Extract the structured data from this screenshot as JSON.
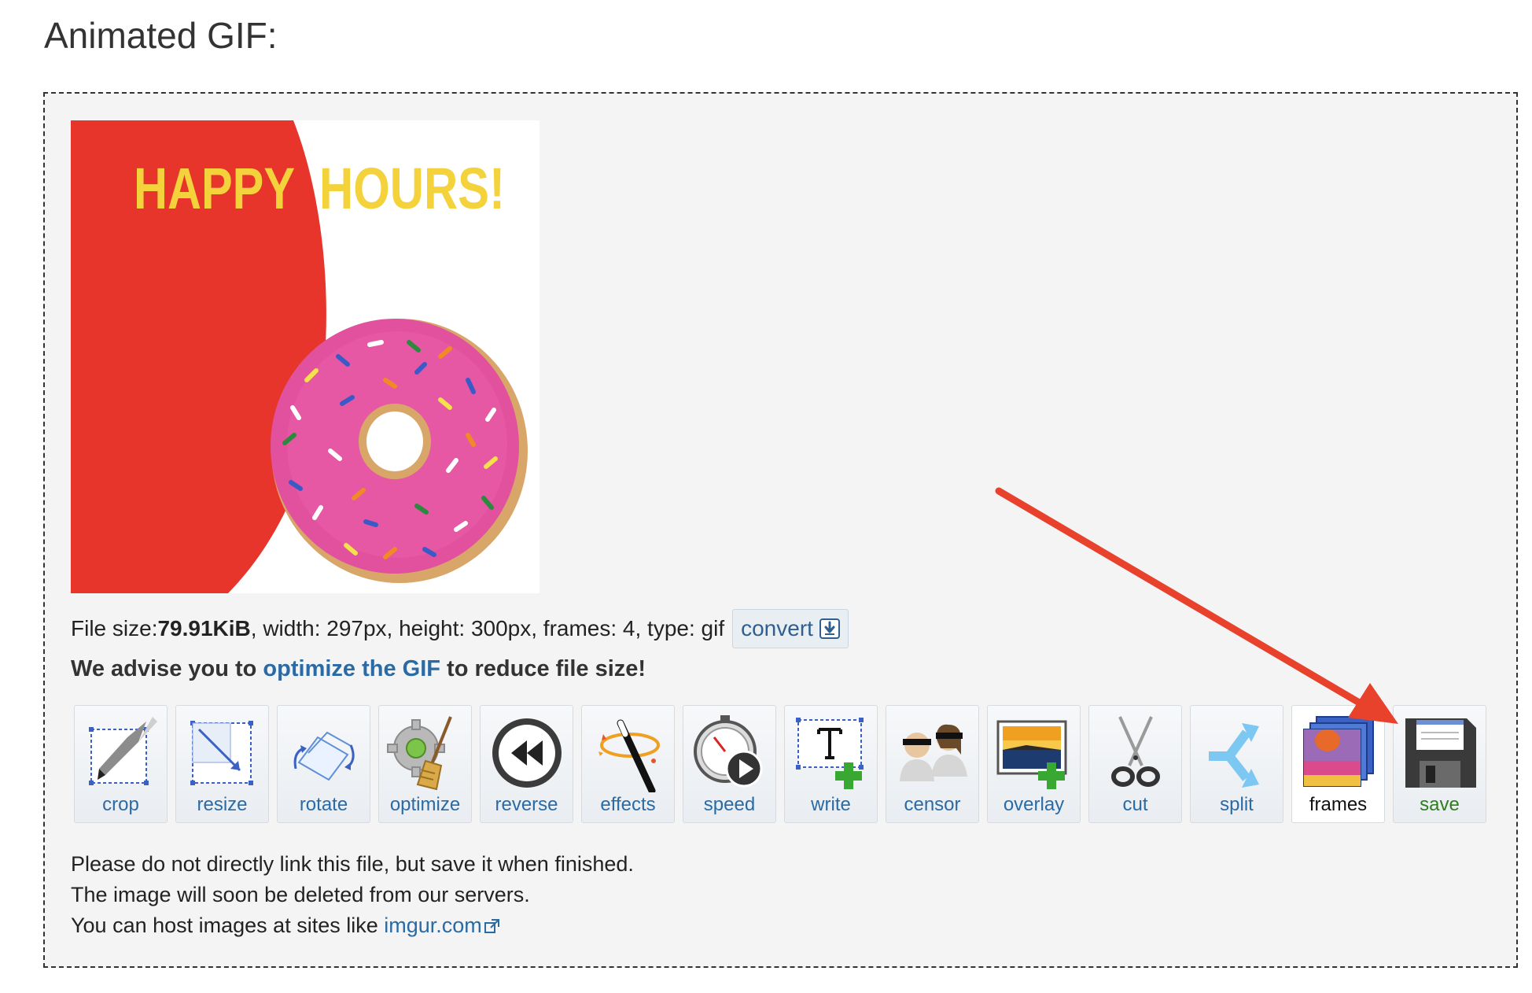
{
  "page_title": "Animated GIF:",
  "preview": {
    "text_left": "HAPPY",
    "text_right": "HOURS!"
  },
  "file_info": {
    "prefix": "File size: ",
    "size": "79.91KiB",
    "details": ", width: 297px, height: 300px, frames: 4, type: gif",
    "convert_label": "convert"
  },
  "advice": {
    "before": "We advise you to ",
    "link": "optimize the GIF",
    "after": " to reduce file size!"
  },
  "tools": [
    {
      "key": "crop",
      "label": "crop"
    },
    {
      "key": "resize",
      "label": "resize"
    },
    {
      "key": "rotate",
      "label": "rotate"
    },
    {
      "key": "optimize",
      "label": "optimize"
    },
    {
      "key": "reverse",
      "label": "reverse"
    },
    {
      "key": "effects",
      "label": "effects"
    },
    {
      "key": "speed",
      "label": "speed"
    },
    {
      "key": "write",
      "label": "write"
    },
    {
      "key": "censor",
      "label": "censor"
    },
    {
      "key": "overlay",
      "label": "overlay"
    },
    {
      "key": "cut",
      "label": "cut"
    },
    {
      "key": "split",
      "label": "split"
    },
    {
      "key": "frames",
      "label": "frames"
    },
    {
      "key": "save",
      "label": "save"
    }
  ],
  "notes": {
    "line1": "Please do not directly link this file, but save it when finished.",
    "line2": "The image will soon be deleted from our servers.",
    "line3_prefix": "You can host images at sites like ",
    "line3_link": "imgur.com"
  },
  "colors": {
    "accent_link": "#2a6aa5",
    "annotation_arrow": "#e8412c",
    "save_label": "#2e7d1f"
  }
}
